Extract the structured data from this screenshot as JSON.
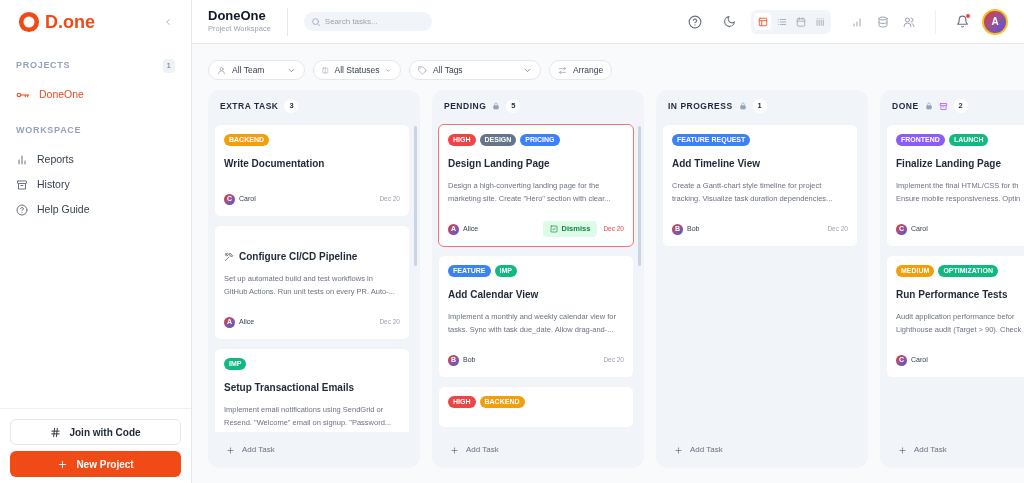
{
  "sidebar": {
    "logo": "D.one",
    "sections": [
      {
        "label": "PROJECTS",
        "count": "1",
        "items": [
          {
            "label": "DoneOne",
            "kind": "project",
            "selected": true
          }
        ]
      },
      {
        "label": "WORKSPACE",
        "items": [
          {
            "label": "Reports",
            "kind": "reports",
            "selected": false
          },
          {
            "label": "History",
            "kind": "history",
            "selected": false
          },
          {
            "label": "Help Guide",
            "kind": "help",
            "selected": false
          }
        ]
      }
    ],
    "buttons": [
      {
        "label": "Join with Code",
        "kind": "join"
      },
      {
        "label": "New Project",
        "kind": "new"
      }
    ]
  },
  "header": {
    "title": "DoneOne",
    "subtitle": "Project Workspace",
    "search": {
      "placeholder": "Search tasks..."
    },
    "views": [
      {
        "kind": "board",
        "selected": true
      },
      {
        "kind": "list",
        "selected": false
      },
      {
        "kind": "calendar",
        "selected": false
      },
      {
        "kind": "columns",
        "selected": false
      }
    ],
    "notification_unread": true,
    "avatar": "A"
  },
  "filters": [
    {
      "label": "All Team",
      "kind": "team"
    },
    {
      "label": "All Statuses",
      "kind": "status"
    },
    {
      "label": "All Tags",
      "kind": "tags"
    },
    {
      "label": "Arrange",
      "kind": "arrange"
    }
  ],
  "columns": [
    {
      "name": "EXTRA TASK",
      "locked": false,
      "archive": false,
      "count": "3",
      "add_label": "Add Task",
      "cards": [
        {
          "tags": [
            {
              "label": "BACKEND",
              "color": "#f59e0b"
            }
          ],
          "title": "Write Documentation",
          "tool_icon": false,
          "assignee": {
            "initial": "C",
            "name": "Carol"
          },
          "date": "Dec 20",
          "overdue": false
        },
        {
          "title": "Configure CI/CD Pipeline",
          "tool_icon": true,
          "description_lines": [
            "Set up automated build and test workflows in",
            "GitHub Actions. Run unit tests on every PR. Auto-..."
          ],
          "assignee": {
            "initial": "A",
            "name": "Alice"
          },
          "date": "Dec 20",
          "overdue": false
        },
        {
          "tags": [
            {
              "label": "IMP",
              "color": "#10b981"
            }
          ],
          "title": "Setup Transactional Emails",
          "tool_icon": false,
          "description_lines": [
            "Implement email notifications using SendGrid or",
            "Resend. \"Welcome\" email on signup. \"Password..."
          ],
          "overdue": false
        }
      ]
    },
    {
      "name": "PENDING",
      "locked": true,
      "archive": false,
      "count": "5",
      "add_label": "Add Task",
      "cards": [
        {
          "tags": [
            {
              "label": "HIGH",
              "color": "#ef4444"
            },
            {
              "label": "DESIGN",
              "color": "#64748b"
            },
            {
              "label": "PRICING",
              "color": "#3b82f6"
            }
          ],
          "title": "Design Landing Page",
          "tool_icon": false,
          "description_lines": [
            "Design a high-converting landing page for the",
            "marketing site. Create \"Hero\" section with clear..."
          ],
          "assignee": {
            "initial": "A",
            "name": "Alice"
          },
          "dismiss": "Dismiss",
          "date": "Dec 20",
          "overdue": true
        },
        {
          "tags": [
            {
              "label": "FEATURE",
              "color": "#3b82f6"
            },
            {
              "label": "IMP",
              "color": "#10b981"
            }
          ],
          "title": "Add Calendar View",
          "tool_icon": false,
          "description_lines": [
            "Implement a monthly and weekly calendar view for",
            "tasks. Sync with task due_date. Allow drag-and-..."
          ],
          "assignee": {
            "initial": "B",
            "name": "Bob"
          },
          "date": "Dec 20",
          "overdue": false
        },
        {
          "tags": [
            {
              "label": "HIGH",
              "color": "#ef4444"
            },
            {
              "label": "BACKEND",
              "color": "#f59e0b"
            }
          ],
          "overdue": false
        }
      ]
    },
    {
      "name": "IN PROGRESS",
      "locked": true,
      "archive": false,
      "count": "1",
      "add_label": "Add Task",
      "cards": [
        {
          "tags": [
            {
              "label": "FEATURE REQUEST",
              "color": "#3b82f6"
            }
          ],
          "title": "Add Timeline View",
          "tool_icon": false,
          "description_lines": [
            "Create a Gantt-chart style timeline for project",
            "tracking. Visualize task duration dependencies..."
          ],
          "assignee": {
            "initial": "B",
            "name": "Bob"
          },
          "date": "Dec 20",
          "overdue": false
        }
      ]
    },
    {
      "name": "DONE",
      "locked": true,
      "archive": true,
      "count": "2",
      "add_label": "Add Task",
      "cards": [
        {
          "tags": [
            {
              "label": "FRONTEND",
              "color": "#8b5cf6"
            },
            {
              "label": "LAUNCH",
              "color": "#10b981"
            }
          ],
          "title": "Finalize Landing Page",
          "tool_icon": false,
          "description_lines": [
            "Implement the final HTML/CSS for th",
            "Ensure mobile responsiveness. Optin"
          ],
          "assignee": {
            "initial": "C",
            "name": "Carol"
          },
          "overdue": false
        },
        {
          "tags": [
            {
              "label": "MEDIUM",
              "color": "#f59e0b"
            },
            {
              "label": "OPTIMIZATION",
              "color": "#10b981"
            }
          ],
          "title": "Run Performance Tests",
          "tool_icon": false,
          "description_lines": [
            "Audit application performance befor",
            "Lighthouse audit (Target > 90). Check"
          ],
          "assignee": {
            "initial": "C",
            "name": "Carol"
          },
          "overdue": false
        }
      ]
    }
  ]
}
